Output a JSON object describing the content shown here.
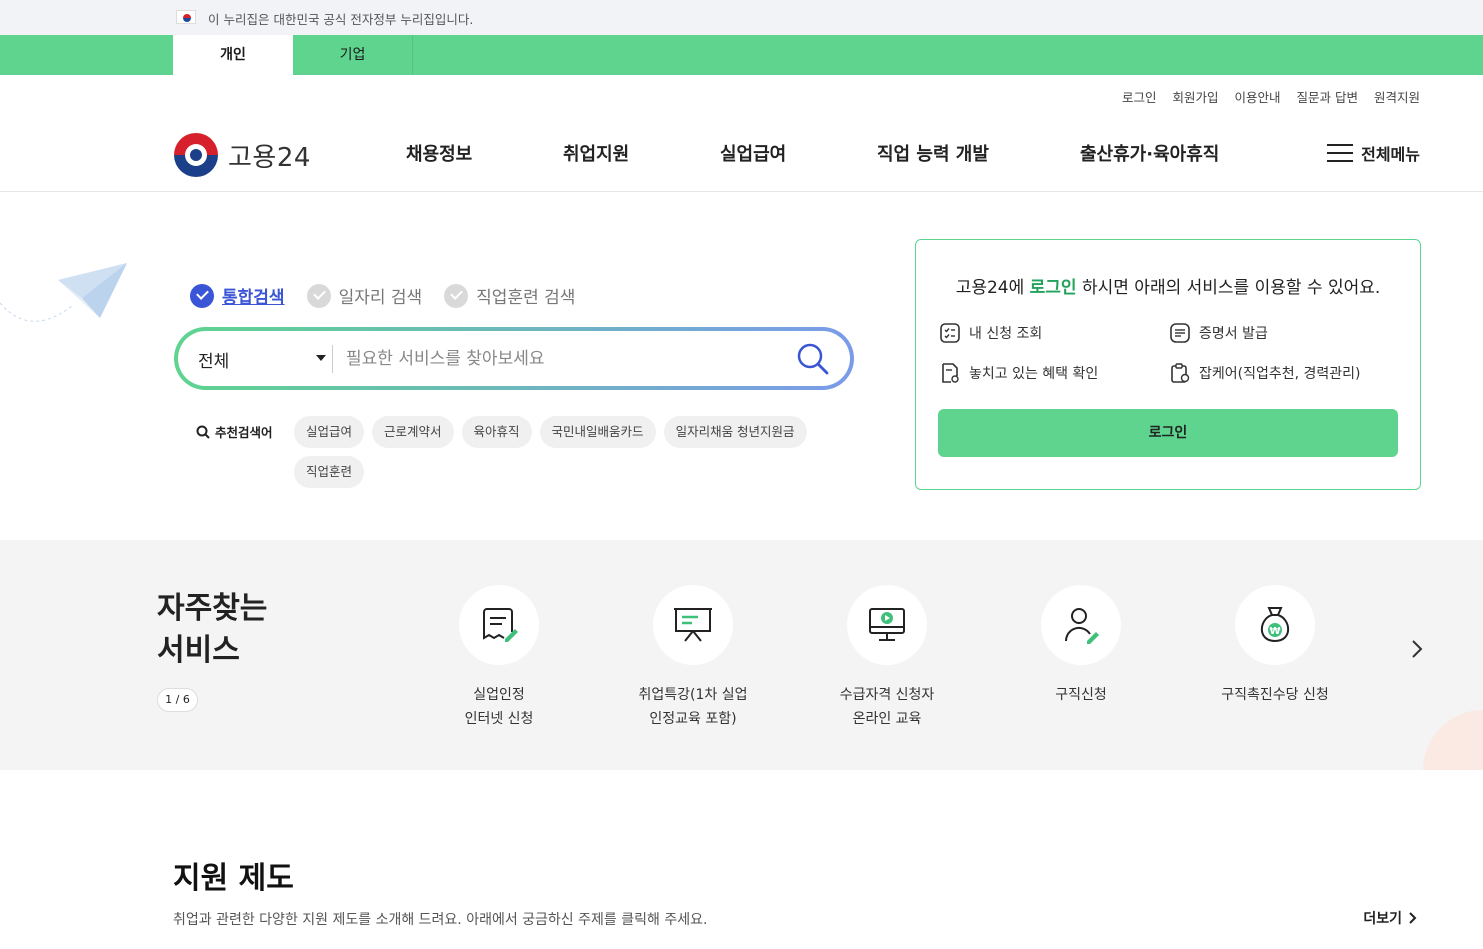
{
  "gov_banner": {
    "text": "이 누리집은 대한민국 공식 전자정부 누리집입니다."
  },
  "user_tabs": [
    {
      "label": "개인",
      "active": true
    },
    {
      "label": "기업",
      "active": false
    }
  ],
  "util_links": [
    "로그인",
    "회원가입",
    "이용안내",
    "질문과 답변",
    "원격지원"
  ],
  "logo": {
    "text": "고용24"
  },
  "nav": [
    "채용정보",
    "취업지원",
    "실업급여",
    "직업 능력 개발",
    "출산휴가·육아휴직"
  ],
  "all_menu": "전체메뉴",
  "search": {
    "tabs": [
      {
        "label": "통합검색",
        "active": true
      },
      {
        "label": "일자리 검색",
        "active": false
      },
      {
        "label": "직업훈련 검색",
        "active": false
      }
    ],
    "category": "전체",
    "placeholder": "필요한 서비스를 찾아보세요",
    "recommend_label": "추천검색어",
    "chips": [
      "실업급여",
      "근로계약서",
      "육아휴직",
      "국민내일배움카드",
      "일자리채움 청년지원금",
      "직업훈련"
    ]
  },
  "login_card": {
    "title_pre": "고용24에 ",
    "title_link": "로그인",
    "title_post": " 하시면 아래의 서비스를 이용할 수 있어요.",
    "items": [
      "내 신청 조회",
      "증명서 발급",
      "놓치고 있는 혜택 확인",
      "잡케어(직업추천, 경력관리)"
    ],
    "button": "로그인"
  },
  "frequent": {
    "title_line1": "자주찾는",
    "title_line2": "서비스",
    "pager": "1 / 6",
    "items": [
      {
        "label": "실업인정\n인터넷 신청",
        "icon": "document-pen-icon"
      },
      {
        "label": "취업특강(1차 실업\n인정교육 포함)",
        "icon": "presentation-board-icon"
      },
      {
        "label": "수급자격 신청자\n온라인 교육",
        "icon": "monitor-play-icon"
      },
      {
        "label": "구직신청",
        "icon": "person-pen-icon"
      },
      {
        "label": "구직촉진수당 신청",
        "icon": "money-bag-icon"
      }
    ]
  },
  "support": {
    "title": "지원 제도",
    "desc": "취업과 관련한 다양한 지원 제도를 소개해 드려요. 아래에서 궁금하신 주제를 클릭해 주세요.",
    "more": "더보기"
  },
  "colors": {
    "brand_green": "#5ed48f",
    "accent_blue": "#3a55d6",
    "text_green": "#22a35b"
  }
}
